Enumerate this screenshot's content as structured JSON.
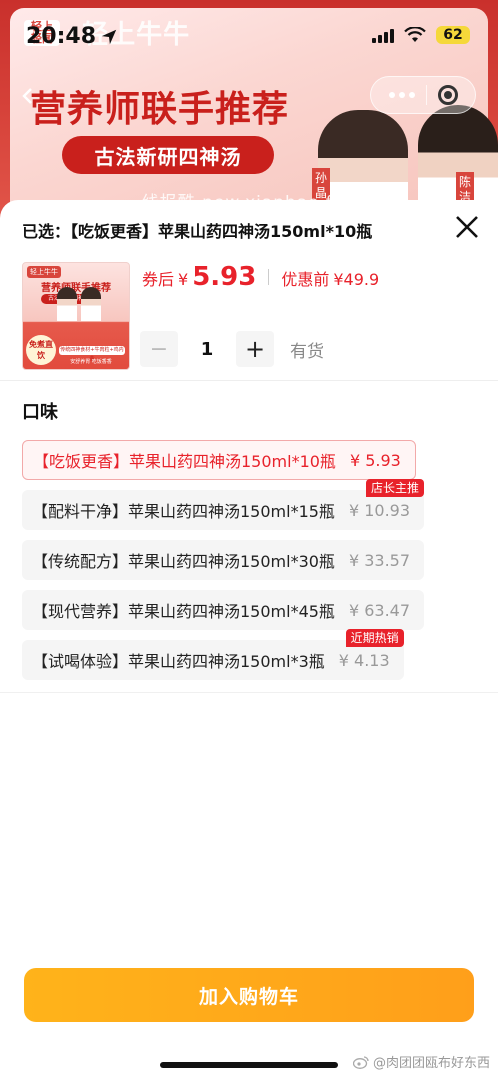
{
  "status_bar": {
    "time": "20:48",
    "battery": "62"
  },
  "banner": {
    "brand_small": "轻上\n轻闻",
    "brand_x": "×",
    "brand_name": "轻上牛牛",
    "headline": "营养师联手推荐",
    "subtitle": "古法新研四神汤",
    "name_a": "孙晶",
    "name_b": "陈洁",
    "watermark": "线报酷 new.xianbao.fun"
  },
  "sheet": {
    "selected_prefix": "已选：",
    "selected_value": "【吃饭更香】苹果山药四神汤150ml*10瓶",
    "thumb": {
      "brand": "轻上牛牛",
      "title": "营养师联手推荐",
      "pill": "古法新研四神汤",
      "badge": "免煮直饮",
      "strip": "传统四神食材+牛肉粒+鸡内金",
      "strip2": "安舒养胃 吃饭香香"
    },
    "price_label": "券后",
    "yen": "¥",
    "price": "5.93",
    "orig_label": "优惠前",
    "orig_price": "¥49.9",
    "qty_minus": "−",
    "qty": "1",
    "qty_plus": "+",
    "stock": "有货",
    "flavor_title": "口味",
    "options": [
      {
        "name": "【吃饭更香】苹果山药四神汤150ml*10瓶",
        "price": "¥ 5.93",
        "tag": ""
      },
      {
        "name": "【配料干净】苹果山药四神汤150ml*15瓶",
        "price": "¥ 10.93",
        "tag": "店长主推"
      },
      {
        "name": "【传统配方】苹果山药四神汤150ml*30瓶",
        "price": "¥ 33.57",
        "tag": ""
      },
      {
        "name": "【现代营养】苹果山药四神汤150ml*45瓶",
        "price": "¥ 63.47",
        "tag": ""
      },
      {
        "name": "【试喝体验】苹果山药四神汤150ml*3瓶",
        "price": "¥ 4.13",
        "tag": "近期热销"
      }
    ],
    "cart_button": "加入购物车",
    "credit": "@肉团团瓯布好东西"
  },
  "colors": {
    "accent": "#e8222b",
    "cart": "#ffa81a",
    "banner": "#c9302c"
  }
}
